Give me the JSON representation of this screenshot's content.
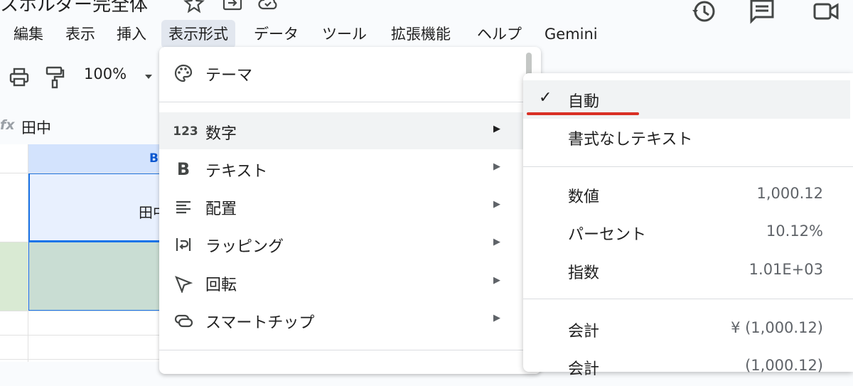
{
  "app": {
    "title": "スホルダー完全体"
  },
  "menubar": {
    "items": [
      {
        "label": "編集"
      },
      {
        "label": "表示"
      },
      {
        "label": "挿入"
      },
      {
        "label": "表示形式"
      },
      {
        "label": "データ"
      },
      {
        "label": "ツール"
      },
      {
        "label": "拡張機能"
      },
      {
        "label": "ヘルプ"
      },
      {
        "label": "Gemini"
      }
    ]
  },
  "toolbar": {
    "zoom": "100%"
  },
  "formula_bar": {
    "fx": "fx",
    "value": "田中"
  },
  "grid": {
    "column_b": "B",
    "cell_b": "田中"
  },
  "format_menu": {
    "items": [
      {
        "label": "テーマ",
        "icon": "palette-icon"
      },
      {
        "label": "数字",
        "icon": "number-123-icon"
      },
      {
        "label": "テキスト",
        "icon": "bold-icon"
      },
      {
        "label": "配置",
        "icon": "align-icon"
      },
      {
        "label": "ラッピング",
        "icon": "wrap-icon"
      },
      {
        "label": "回転",
        "icon": "rotate-icon"
      },
      {
        "label": "スマートチップ",
        "icon": "smart-chip-icon"
      }
    ],
    "arrow": "▶"
  },
  "number_submenu": {
    "check": "✓",
    "items": [
      {
        "label": "自動",
        "value": ""
      },
      {
        "label": "書式なしテキスト",
        "value": ""
      },
      {
        "label": "数値",
        "value": "1,000.12"
      },
      {
        "label": "パーセント",
        "value": "10.12%"
      },
      {
        "label": "指数",
        "value": "1.01E+03"
      },
      {
        "label": "会計",
        "value": "¥ (1,000.12)"
      },
      {
        "label": "会計",
        "value": "(1,000.12)"
      }
    ]
  }
}
